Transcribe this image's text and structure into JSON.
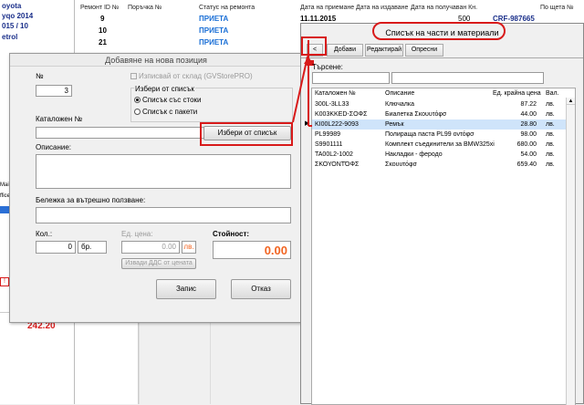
{
  "bg": {
    "car_lines": [
      "oyota",
      "yqo 2014",
      "015   / 10",
      "etrol"
    ],
    "columns": [
      "Ремонт ID №",
      "Поръчка №",
      "Статус на ремонта",
      "Дата на приемане",
      "Дата на издаване",
      "Дата на получаван Кн.",
      "По щета №"
    ],
    "rows": [
      {
        "id": "9",
        "status": "ПРИЕТА",
        "date": "11.11.2015",
        "amount": "500",
        "claim": "CRF-987665"
      },
      {
        "id": "10",
        "status": "ПРИЕТА"
      },
      {
        "id": "21",
        "status": "ПРИЕТА"
      }
    ],
    "total": "242.20",
    "side_frag": [
      "Mail",
      "ffice"
    ]
  },
  "dialog": {
    "title": "Добавяне на нова позиция",
    "num_label": "№",
    "num_value": "3",
    "warehouse_check": "Изписвай от склад (GVStorePRO)",
    "choose_label": "Избери от списък",
    "radio_goods": "Списък със стоки",
    "radio_packages": "Списък с пакети",
    "catalog_label": "Каталожен №",
    "choose_button": "Избери от списък",
    "desc_label": "Описание:",
    "note_label": "Бележка за вътрешно ползване:",
    "qty_label": "Кол.:",
    "qty_value": "0",
    "unit": "бр.",
    "unit_price_label": "Ед. цена:",
    "unit_price_value": "0.00",
    "currency": "лв.",
    "vat_button": "Извади ДДС от цената",
    "cost_label": "Стойност:",
    "cost_value": "0.00",
    "save_button": "Запис",
    "cancel_button": "Отказ"
  },
  "list": {
    "title": "Списък на части и материали",
    "back": "<",
    "tabs": [
      "Добави",
      "Редактирай",
      "Опресни"
    ],
    "search_label": "Търсене:",
    "columns": [
      "Каталожен №",
      "Описание",
      "Ед. крайна цена",
      "Вал."
    ],
    "rows": [
      {
        "code": "300L-3LL33",
        "desc": "Ключалка",
        "price": "87.22",
        "cur": "лв."
      },
      {
        "code": "K003KKED-ΣΟΦΣ",
        "desc": "Биалетка Σκουυτόφσ",
        "price": "44.00",
        "cur": "лв."
      },
      {
        "code": "KI00L222-9093",
        "desc": "Ремък",
        "price": "28.80",
        "cur": "лв."
      },
      {
        "code": "PL99989",
        "desc": "Полираща паста PL99 οντόφσ",
        "price": "98.00",
        "cur": "лв."
      },
      {
        "code": "S9901111",
        "desc": "Комплект съединители за BMW325xi",
        "price": "680.00",
        "cur": "лв."
      },
      {
        "code": "TA00L2-1002",
        "desc": "Накладки - феродо",
        "price": "54.00",
        "cur": "лв."
      },
      {
        "code": "ΣΚΟΥΟΝΤΌΦΣ",
        "desc": "Σκουυτόφσ",
        "price": "659.40",
        "cur": "лв."
      }
    ]
  },
  "colors": {
    "highlight": "#d81a1a",
    "cost": "#f26522",
    "status": "#1a6fd6"
  }
}
